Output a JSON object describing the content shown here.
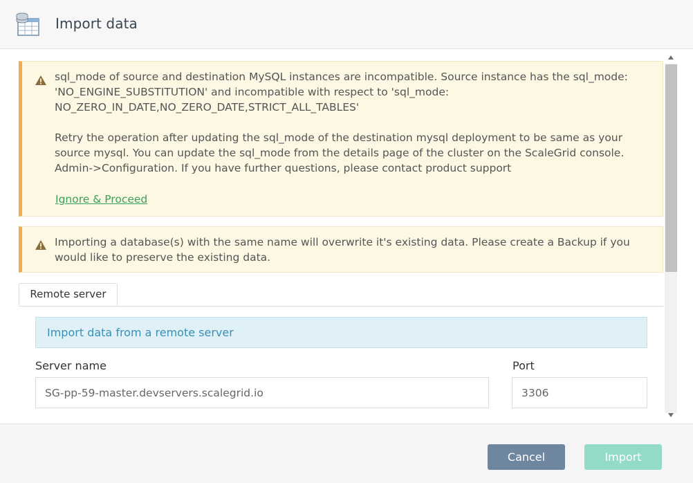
{
  "dialog": {
    "title": "Import data",
    "icon": "database-table-icon"
  },
  "alerts": {
    "sql_mode": {
      "icon": "warning-icon",
      "line1": "sql_mode of source and destination MySQL instances are incompatible. Source instance has the sql_mode: 'NO_ENGINE_SUBSTITUTION' and incompatible with respect to 'sql_mode: NO_ZERO_IN_DATE,NO_ZERO_DATE,STRICT_ALL_TABLES'",
      "line2": "Retry the operation after updating the sql_mode of the destination mysql deployment to be same as your source mysql. You can update the sql_mode from the details page of the cluster on the ScaleGrid console. Admin->Configuration. If you have further questions, please contact product support",
      "link": "Ignore & Proceed"
    },
    "overwrite": {
      "icon": "warning-icon",
      "text": "Importing a database(s) with the same name will overwrite it's existing data. Please create a Backup if you would like to preserve the existing data."
    }
  },
  "tabs": [
    {
      "label": "Remote server",
      "active": true
    }
  ],
  "info": "Import data from a remote server",
  "form": {
    "server_name_label": "Server name",
    "server_name_value": "SG-pp-59-master.devservers.scalegrid.io",
    "port_label": "Port",
    "port_value": "3306",
    "cut_label": "..."
  },
  "footer": {
    "cancel_label": "Cancel",
    "import_label": "Import"
  },
  "colors": {
    "warning_accent": "#f0ad4e",
    "warning_bg": "#fcf8e3",
    "link_green": "#3c9f5a",
    "info_bg": "#dff0f7",
    "info_text": "#3a8fb7",
    "cancel_bg": "#6f86a0",
    "import_bg": "#93dac9"
  }
}
